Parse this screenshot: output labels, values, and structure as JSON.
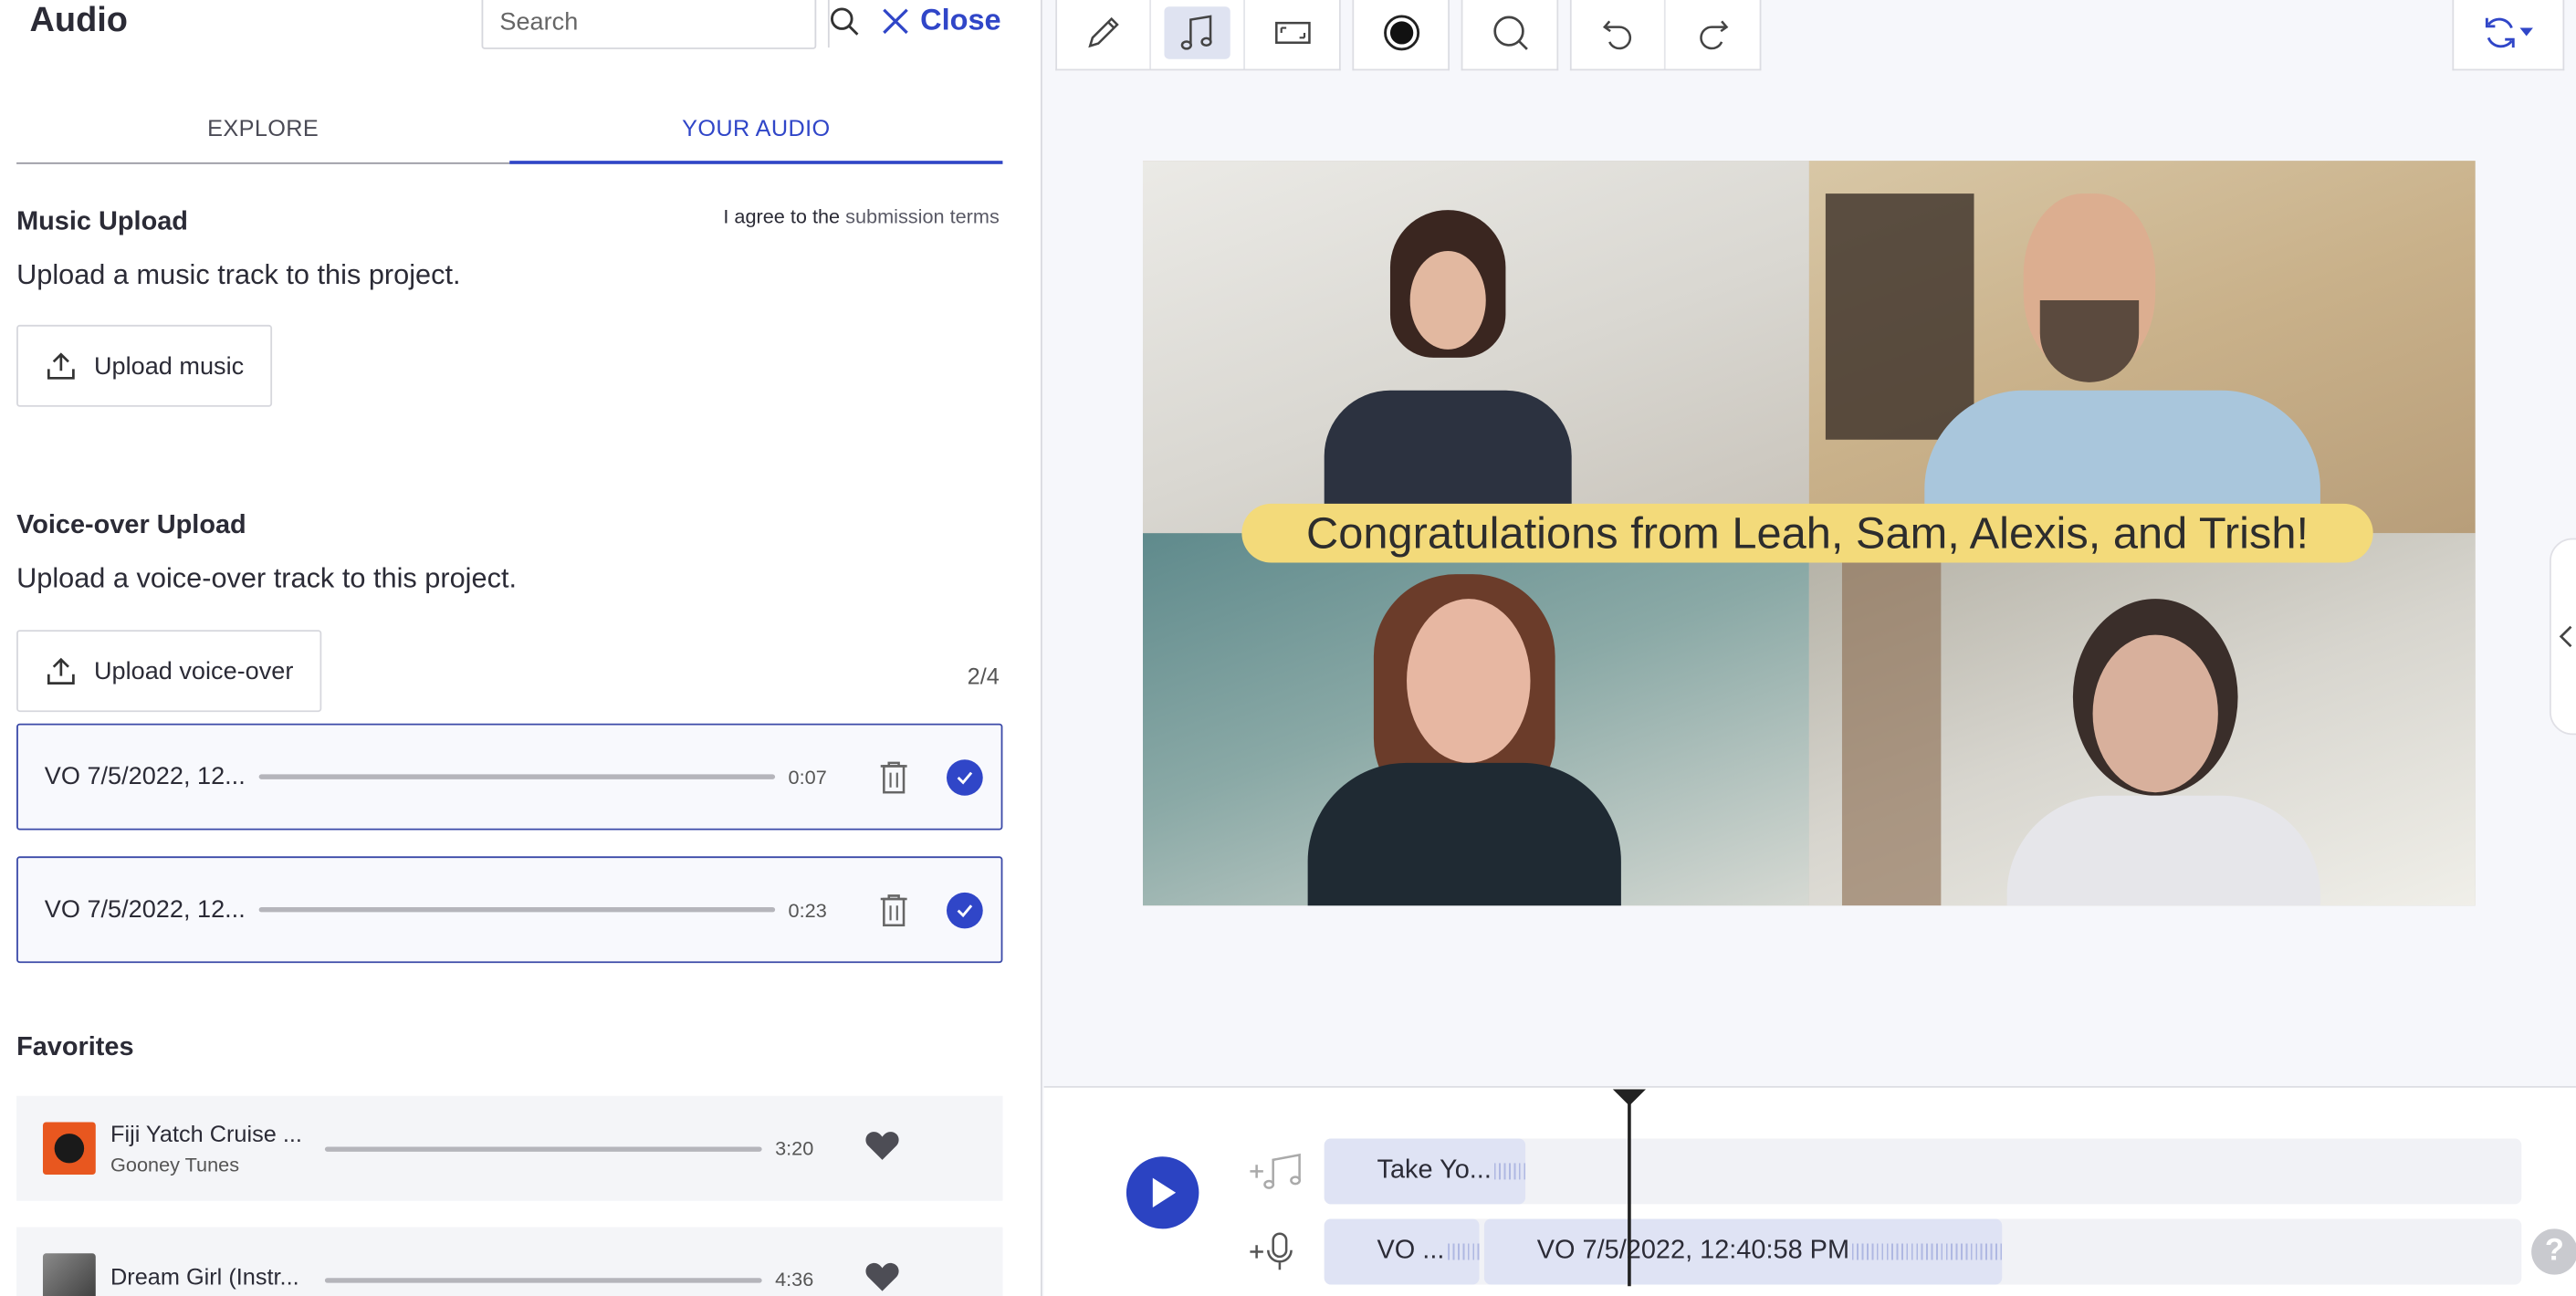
{
  "panel": {
    "title": "Audio",
    "search_placeholder": "Search",
    "close_label": "Close"
  },
  "tabs": [
    {
      "label": "EXPLORE",
      "active": false
    },
    {
      "label": "YOUR AUDIO",
      "active": true
    }
  ],
  "music_upload": {
    "title": "Music Upload",
    "description": "Upload a music track to this project.",
    "agree_prefix": "I agree to the",
    "agree_link": "submission terms",
    "button_label": "Upload music"
  },
  "voiceover_upload": {
    "title": "Voice-over Upload",
    "description": "Upload a voice-over track to this project.",
    "button_label": "Upload voice-over",
    "count": "2/4",
    "items": [
      {
        "name": "VO 7/5/2022, 12...",
        "duration": "0:07",
        "selected": true
      },
      {
        "name": "VO 7/5/2022, 12...",
        "duration": "0:23",
        "selected": true
      }
    ]
  },
  "favorites": {
    "title": "Favorites",
    "items": [
      {
        "title": "Fiji Yatch Cruise ...",
        "artist": "Gooney Tunes",
        "duration": "3:20"
      },
      {
        "title": "Dream Girl (Instr...",
        "artist": "",
        "duration": "4:36"
      }
    ]
  },
  "toolbar": {
    "icons": [
      "pencil-icon",
      "music-note-icon",
      "aspect-ratio-icon",
      "record-icon",
      "search-icon",
      "undo-icon",
      "redo-icon",
      "refresh-icon"
    ],
    "active": "music-note-icon"
  },
  "preview": {
    "banner_text": "Congratulations from Leah, Sam, Alexis, and Trish!"
  },
  "timeline": {
    "music_clip_label": "Take Yo...",
    "vo_clip_1_label": "VO ...",
    "vo_clip_2_label": "VO 7/5/2022, 12:40:58 PM",
    "help_label": "?"
  },
  "colors": {
    "accent": "#3046c8",
    "banner": "#f3da7a"
  }
}
